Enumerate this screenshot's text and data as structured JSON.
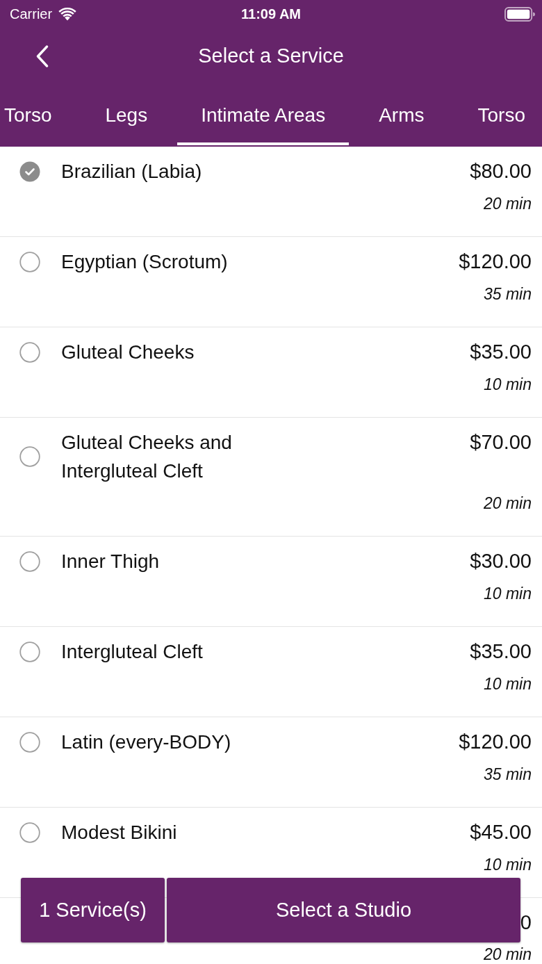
{
  "status_bar": {
    "carrier": "Carrier",
    "time": "11:09 AM"
  },
  "nav_bar": {
    "title": "Select a Service"
  },
  "tabs": [
    {
      "label": "Torso",
      "selected": false
    },
    {
      "label": "Legs",
      "selected": false
    },
    {
      "label": "Intimate Areas",
      "selected": true
    },
    {
      "label": "Arms",
      "selected": false
    },
    {
      "label": "Torso",
      "selected": false
    }
  ],
  "services": [
    {
      "name": "Brazilian (Labia)",
      "price": "$80.00",
      "duration": "20 min",
      "selected": true
    },
    {
      "name": "Egyptian (Scrotum)",
      "price": "$120.00",
      "duration": "35 min",
      "selected": false
    },
    {
      "name": "Gluteal Cheeks",
      "price": "$35.00",
      "duration": "10 min",
      "selected": false
    },
    {
      "name": "Gluteal Cheeks and Intergluteal Cleft",
      "price": "$70.00",
      "duration": "20 min",
      "selected": false
    },
    {
      "name": "Inner Thigh",
      "price": "$30.00",
      "duration": "10 min",
      "selected": false
    },
    {
      "name": "Intergluteal Cleft",
      "price": "$35.00",
      "duration": "10 min",
      "selected": false
    },
    {
      "name": "Latin (every-BODY)",
      "price": "$120.00",
      "duration": "35 min",
      "selected": false
    },
    {
      "name": "Modest Bikini",
      "price": "$45.00",
      "duration": "10 min",
      "selected": false
    }
  ],
  "partial_row": {
    "price": "0",
    "duration": "20 min"
  },
  "footer": {
    "count_button": "1 Service(s)",
    "action_button": "Select a Studio"
  }
}
